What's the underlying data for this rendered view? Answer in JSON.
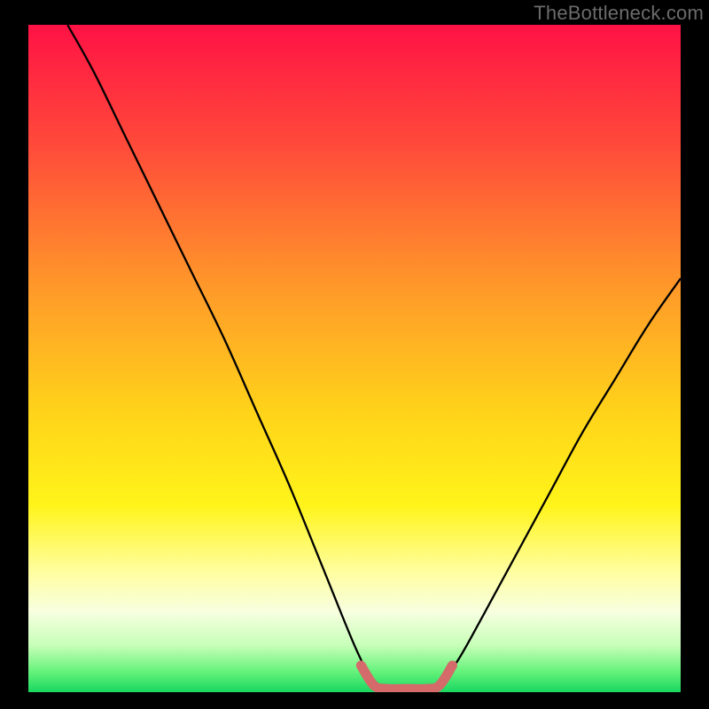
{
  "watermark": "TheBottleneck.com",
  "chart_data": {
    "type": "line",
    "title": "",
    "xlabel": "",
    "ylabel": "",
    "xlim": [
      0,
      100
    ],
    "ylim": [
      0,
      100
    ],
    "series": [
      {
        "name": "curve-left",
        "x": [
          6,
          10,
          15,
          20,
          25,
          30,
          35,
          40,
          45,
          50,
          53
        ],
        "y": [
          100,
          93,
          83,
          73,
          63,
          53,
          42,
          31,
          19,
          7,
          1
        ]
      },
      {
        "name": "curve-right",
        "x": [
          63,
          66,
          70,
          75,
          80,
          85,
          90,
          95,
          100
        ],
        "y": [
          1,
          5,
          12,
          21,
          30,
          39,
          47,
          55,
          62
        ]
      },
      {
        "name": "bottom-accent",
        "x": [
          51,
          53,
          55,
          58,
          61,
          63,
          65
        ],
        "y": [
          4,
          1,
          0.5,
          0.5,
          0.5,
          1,
          4
        ]
      }
    ],
    "gradient_stops": [
      {
        "offset": 0.0,
        "color": "#ff1245"
      },
      {
        "offset": 0.18,
        "color": "#ff4a3a"
      },
      {
        "offset": 0.4,
        "color": "#ff9b29"
      },
      {
        "offset": 0.58,
        "color": "#ffd31a"
      },
      {
        "offset": 0.72,
        "color": "#fff41a"
      },
      {
        "offset": 0.82,
        "color": "#fffea0"
      },
      {
        "offset": 0.88,
        "color": "#f7ffe0"
      },
      {
        "offset": 0.93,
        "color": "#c7ffb8"
      },
      {
        "offset": 0.97,
        "color": "#63f27a"
      },
      {
        "offset": 1.0,
        "color": "#18d760"
      }
    ]
  }
}
